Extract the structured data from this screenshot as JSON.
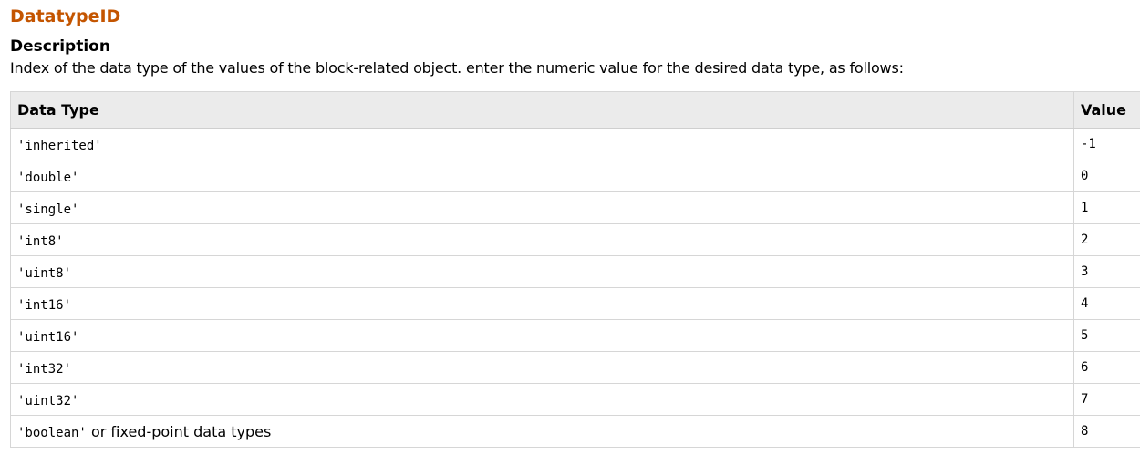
{
  "property": {
    "name": "DatatypeID",
    "name_color": "#c45500"
  },
  "description": {
    "heading": "Description",
    "text": "Index of the data type of the values of the block-related object. enter the numeric value for the desired data type, as follows:"
  },
  "table": {
    "headers": {
      "data_type": "Data Type",
      "value": "Value"
    },
    "rows": [
      {
        "data_type": "'inherited'",
        "suffix": "",
        "value": "-1"
      },
      {
        "data_type": "'double'",
        "suffix": "",
        "value": "0"
      },
      {
        "data_type": "'single'",
        "suffix": "",
        "value": "1"
      },
      {
        "data_type": "'int8'",
        "suffix": "",
        "value": "2"
      },
      {
        "data_type": "'uint8'",
        "suffix": "",
        "value": "3"
      },
      {
        "data_type": "'int16'",
        "suffix": "",
        "value": "4"
      },
      {
        "data_type": "'uint16'",
        "suffix": "",
        "value": "5"
      },
      {
        "data_type": "'int32'",
        "suffix": "",
        "value": "6"
      },
      {
        "data_type": "'uint32'",
        "suffix": "",
        "value": "7"
      },
      {
        "data_type": "'boolean'",
        "suffix": " or fixed-point data types",
        "value": "8"
      }
    ]
  }
}
